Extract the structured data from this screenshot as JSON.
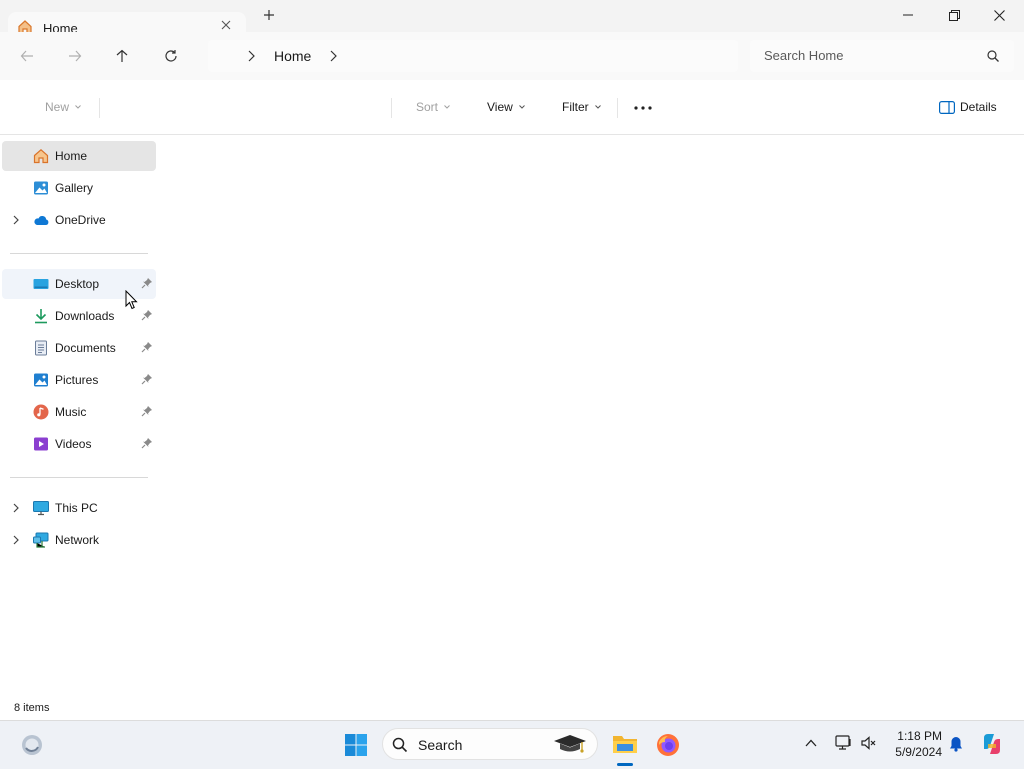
{
  "window": {
    "tab_title": "Home",
    "tab_icon": "home-icon",
    "controls": [
      "minimize",
      "maximize",
      "close"
    ]
  },
  "address_bar": {
    "breadcrumbs": [
      "Home"
    ],
    "search_placeholder": "Search Home"
  },
  "command_bar": {
    "new_label": "New",
    "sort_label": "Sort",
    "view_label": "View",
    "filter_label": "Filter",
    "details_label": "Details"
  },
  "nav_pane": {
    "quick_items": [
      {
        "label": "Home",
        "icon": "home-icon",
        "selected": true
      },
      {
        "label": "Gallery",
        "icon": "gallery-icon"
      },
      {
        "label": "OneDrive",
        "icon": "onedrive-icon",
        "expandable": true
      }
    ],
    "pinned_items": [
      {
        "label": "Desktop",
        "icon": "desktop-icon",
        "pinned": true,
        "hover": true
      },
      {
        "label": "Downloads",
        "icon": "downloads-icon",
        "pinned": true
      },
      {
        "label": "Documents",
        "icon": "documents-icon",
        "pinned": true
      },
      {
        "label": "Pictures",
        "icon": "pictures-icon",
        "pinned": true
      },
      {
        "label": "Music",
        "icon": "music-icon",
        "pinned": true
      },
      {
        "label": "Videos",
        "icon": "videos-icon",
        "pinned": true
      }
    ],
    "device_items": [
      {
        "label": "This PC",
        "icon": "this-pc-icon",
        "expandable": true
      },
      {
        "label": "Network",
        "icon": "network-icon",
        "expandable": true
      }
    ]
  },
  "status_bar": {
    "item_count": "8 items"
  },
  "taskbar": {
    "search_label": "Search",
    "clock_time": "1:18 PM",
    "clock_date": "5/9/2024",
    "apps": [
      "start-icon",
      "file-explorer-icon",
      "firefox-icon"
    ]
  },
  "colors": {
    "accent": "#0067c0",
    "selection": "#e5e5e5",
    "hover": "#f0f4fa",
    "chrome": "#f3f3f3"
  }
}
